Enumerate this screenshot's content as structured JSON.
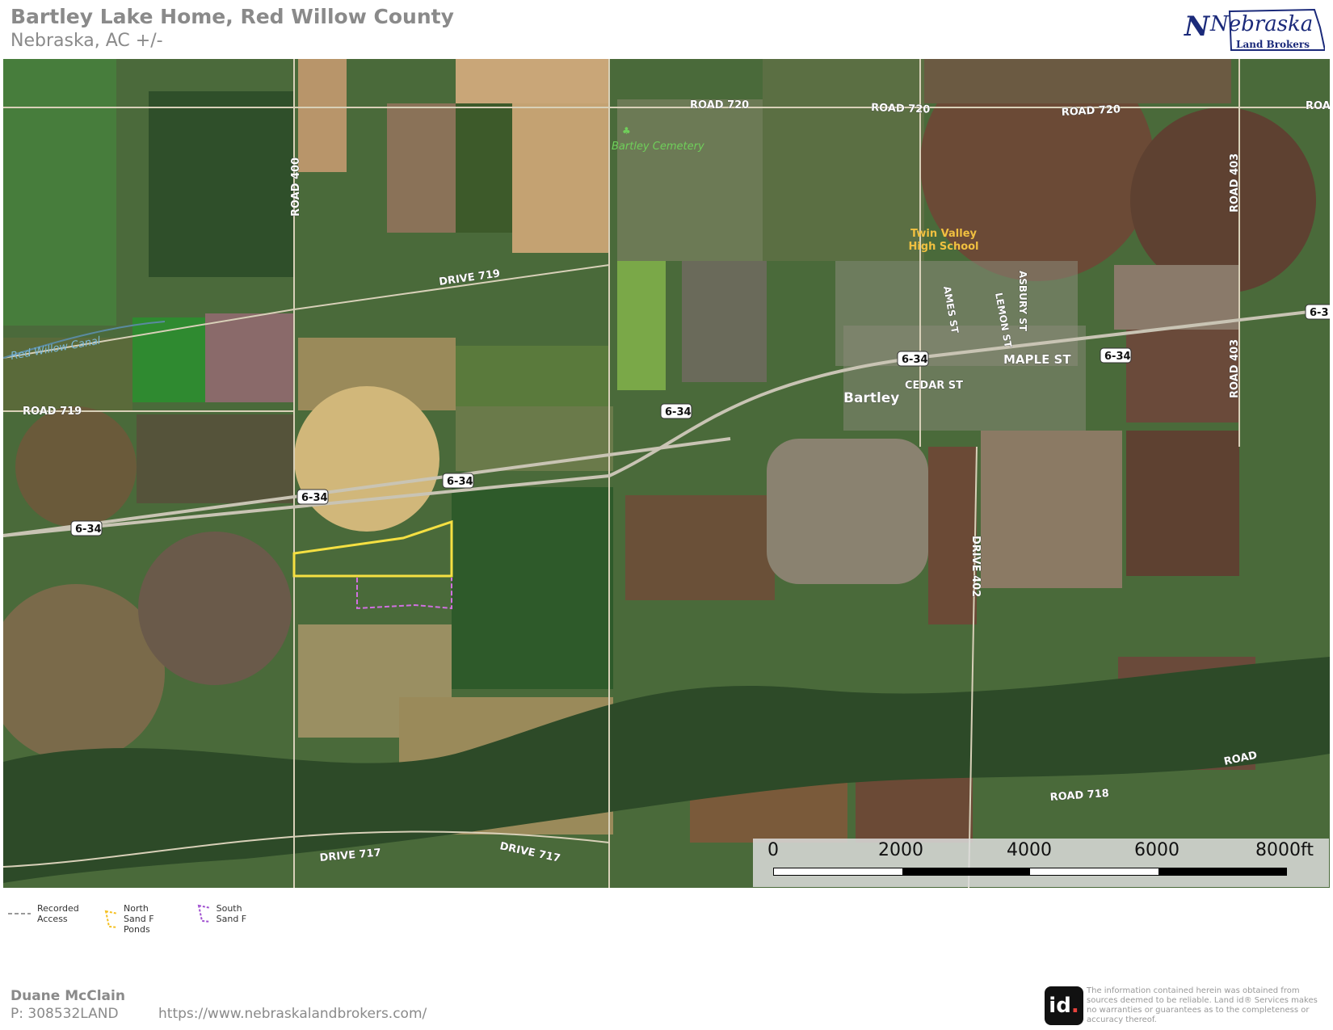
{
  "header": {
    "title": "Bartley Lake Home, Red Willow County",
    "subtitle": "Nebraska,  AC +/-",
    "logo_line1": "Nebraska",
    "logo_line2": "Land Brokers"
  },
  "map": {
    "roads": {
      "road720_a": "ROAD 720",
      "road720_b": "ROAD 720",
      "road720_c": "ROAD 720",
      "road720_d": "ROA",
      "road400": "ROAD 400",
      "drive719": "DRIVE 719",
      "road719": "ROAD 719",
      "hwy_a": "6-34",
      "hwy_b": "6-34",
      "hwy_c": "6-34",
      "hwy_d": "6-34",
      "hwy_e": "6-34",
      "hwy_f": "6-34",
      "hwy_g": "6-3",
      "maple": "MAPLE ST",
      "cedar": "CEDAR ST",
      "ames": "AMES ST",
      "lemon": "LEMON ST",
      "asbury": "ASBURY ST",
      "drive402": "DRIVE 402",
      "road403_a": "ROAD 403",
      "road403_b": "ROAD 403",
      "drive717_a": "DRIVE 717",
      "drive717_b": "DRIVE 717",
      "road718": "ROAD 718",
      "road_edge": "ROAD"
    },
    "places": {
      "cemetery": "Bartley Cemetery",
      "school_line1": "Twin Valley",
      "school_line2": "High School",
      "town": "Bartley",
      "canal": "Red Willow Canal"
    },
    "colors": {
      "north_parcel": "#f5e042",
      "south_parcel": "#d070e0"
    }
  },
  "scale_bar": {
    "ticks": [
      "0",
      "2000",
      "4000",
      "6000",
      "8000ft"
    ]
  },
  "legend": [
    {
      "label_line1": "Recorded",
      "label_line2": "Access",
      "icon": "dashed-line-icon"
    },
    {
      "label_line1": "North Sand F",
      "label_line2": "Ponds",
      "icon": "yellow-polygon-icon"
    },
    {
      "label_line1": "South Sand F",
      "label_line2": "",
      "icon": "purple-polygon-icon"
    }
  ],
  "footer": {
    "agent_name": "Duane McClain",
    "phone": "P: 308532LAND",
    "website": "https://www.nebraskalandbrokers.com/",
    "id_logo": "id",
    "id_logo_dot": ".",
    "disclaimer": "The information contained herein was obtained from sources deemed to be reliable. Land id® Services makes no warranties or guarantees as to the completeness or accuracy thereof."
  }
}
